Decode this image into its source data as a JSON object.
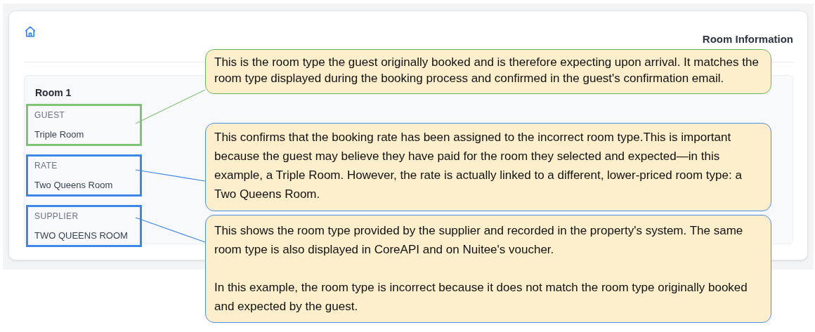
{
  "header": {
    "title": "Room Information"
  },
  "room": {
    "title": "Room 1",
    "fields": [
      {
        "label": "GUEST",
        "value": "Triple Room",
        "color": "#7fc474"
      },
      {
        "label": "RATE",
        "value": "Two Queens Room",
        "color": "#3c87e8"
      },
      {
        "label": "SUPPLIER",
        "value": "TWO QUEENS ROOM",
        "color": "#3c87e8"
      }
    ]
  },
  "callouts": [
    {
      "color": "#6ab35c",
      "paragraphs": [
        "This is the room type the guest originally booked and is therefore expecting upon arrival. It matches the room type displayed during the booking process and confirmed in the guest's confirmation email."
      ]
    },
    {
      "color": "#4a8ee6",
      "paragraphs": [
        "This confirms that the booking rate has been assigned to the incorrect room type.This is important because the guest may believe they have paid for the room they selected and expected—in this example, a Triple Room. However, the rate is actually linked to a different, lower-priced room type: a Two Queens Room."
      ]
    },
    {
      "color": "#4a8ee6",
      "paragraphs": [
        "This shows the room type provided by the supplier and recorded in the property's system. The same room type is also displayed in CoreAPI and on Nuitee's voucher.",
        "In this example, the room type is incorrect because it does not match the room type originally booked and expected by the guest."
      ]
    }
  ]
}
